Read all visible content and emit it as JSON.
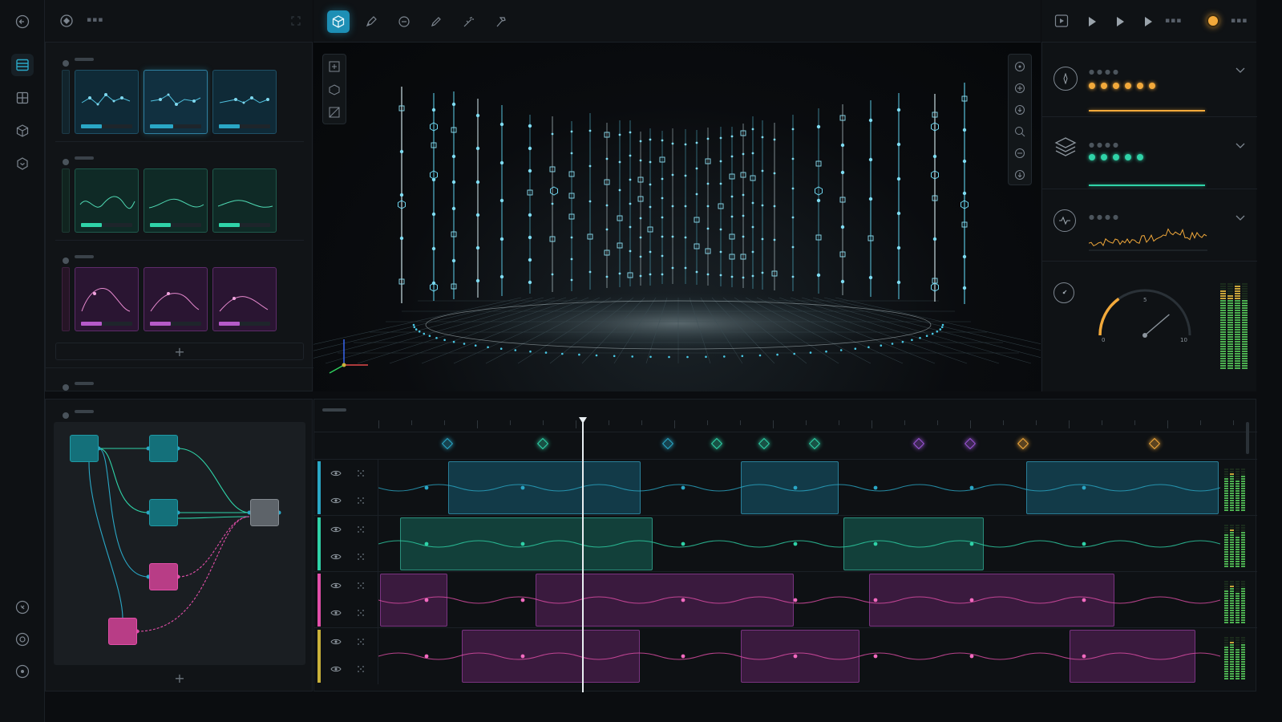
{
  "colors": {
    "cyan": "#2aa7c6",
    "teal": "#2fd3a8",
    "pink": "#e24fa9",
    "orange": "#f2a93b",
    "purple": "#9b55d6",
    "gray": "#7d8690"
  },
  "rail": {
    "icons": [
      "back-arrow-icon",
      "layers-list-icon",
      "grid-icon",
      "cube-icon",
      "shield-icon",
      "search-icon",
      "settings-icon",
      "help-icon"
    ]
  },
  "header": {
    "tools": [
      "cube-icon",
      "pen-tool-icon",
      "rotate-icon",
      "brush-icon",
      "magic-wand-icon",
      "hammer-icon"
    ],
    "transport": [
      "preview-play-icon",
      "play-icon",
      "step-play-icon",
      "fast-play-icon"
    ]
  },
  "left_panel": {
    "groups": [
      {
        "name": "cyan-group",
        "color": "#2aa7c6",
        "progress": [
          0.45,
          0.45,
          0.45
        ]
      },
      {
        "name": "teal-group",
        "color": "#2fd3a8",
        "progress": [
          0.45,
          0.45,
          0.45
        ]
      },
      {
        "name": "pink-group",
        "color": "#e24fa9",
        "progress": [
          0.45,
          0.45,
          0.45
        ]
      }
    ],
    "add_label": "+"
  },
  "node_editor": {
    "add_label": "+"
  },
  "right_panel": {
    "sections": [
      {
        "icon": "compass-icon",
        "color": "#f2a93b",
        "dots": 6
      },
      {
        "icon": "stack-icon",
        "color": "#2fd3a8",
        "dots": 5
      },
      {
        "icon": "waveform-icon",
        "color": "#f2a93b",
        "dots": 0
      }
    ],
    "gauge": {
      "min_label": "0",
      "max_label": "10",
      "mid_label": "5",
      "value": 0.55
    }
  },
  "timeline": {
    "tracks": [
      {
        "color": "#2aa7c6"
      },
      {
        "color": "#2fd3a8"
      },
      {
        "color": "#e24fa9"
      },
      {
        "color": "#c9b13a"
      }
    ]
  }
}
